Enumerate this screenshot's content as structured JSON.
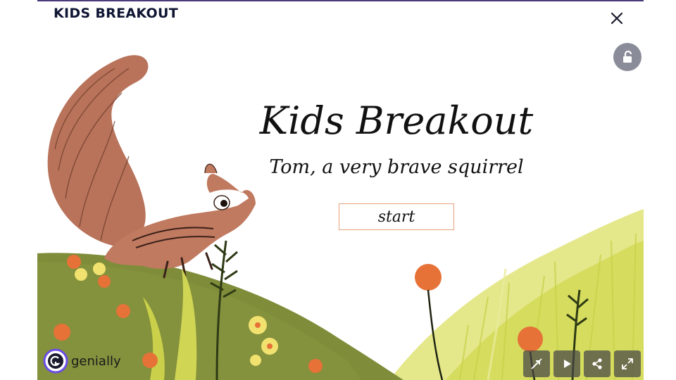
{
  "header": {
    "title": "KIDS BREAKOUT"
  },
  "presentation": {
    "title": "Kids Breakout",
    "subtitle": "Tom, a very brave squirrel",
    "start_label": "start"
  },
  "branding": {
    "logo_text": "genially"
  },
  "icons": {
    "close": "close-icon",
    "lock": "unlock-icon",
    "hide_interactivity": "interactivity-off-icon",
    "play": "play-icon",
    "share": "share-icon",
    "fullscreen": "fullscreen-icon"
  },
  "colors": {
    "header_text": "#0f1533",
    "accent_border": "#e7a27a",
    "hill": "#7f8d3a",
    "grass": "#d9e06a"
  }
}
